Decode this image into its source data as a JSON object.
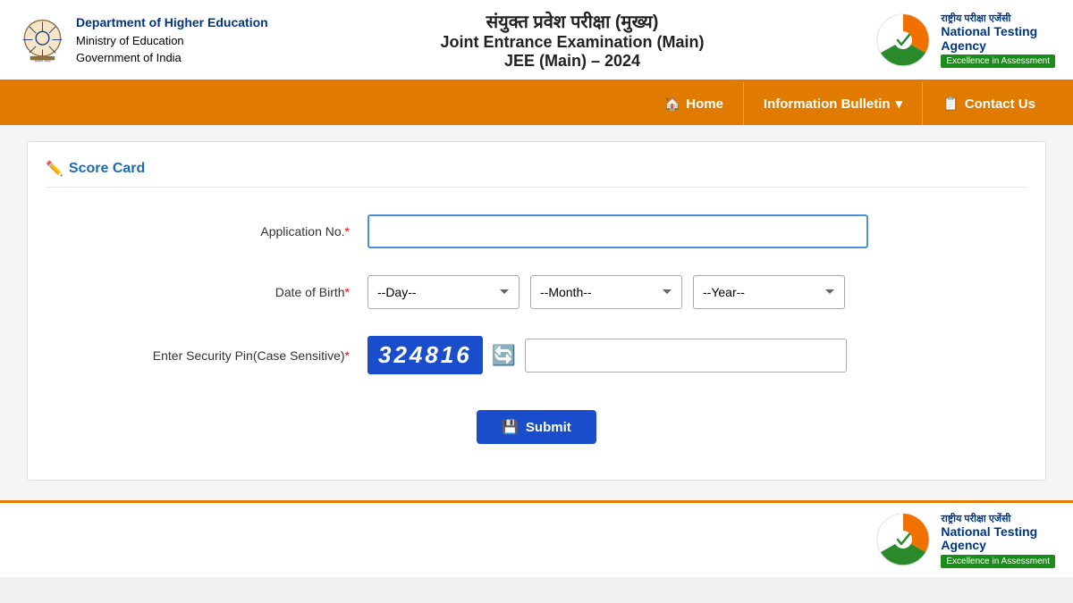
{
  "header": {
    "dept_line1": "Department of Higher Education",
    "dept_line2": "Ministry of Education",
    "dept_line3": "Government of India",
    "hindi_title": "संयुक्त प्रवेश परीक्षा (मुख्य)",
    "eng_title": "Joint Entrance Examination (Main)",
    "year_title": "JEE (Main) – 2024",
    "nta_hindi": "राष्ट्रीय परीक्षा एजेंसी",
    "nta_english_line1": "National Testing",
    "nta_english_line2": "Agency",
    "nta_tagline": "Excellence in Assessment"
  },
  "navbar": {
    "home_label": "Home",
    "info_bulletin_label": "Information Bulletin",
    "contact_us_label": "Contact Us"
  },
  "card": {
    "title": "Score Card",
    "app_no_label": "Application No.",
    "app_no_placeholder": "",
    "dob_label": "Date of Birth",
    "dob_day_placeholder": "--Day--",
    "dob_month_placeholder": "--Month--",
    "dob_year_placeholder": "--Year--",
    "security_label": "Enter Security Pin(Case Sensitive)",
    "captcha_text": "324816",
    "submit_label": "Submit"
  }
}
